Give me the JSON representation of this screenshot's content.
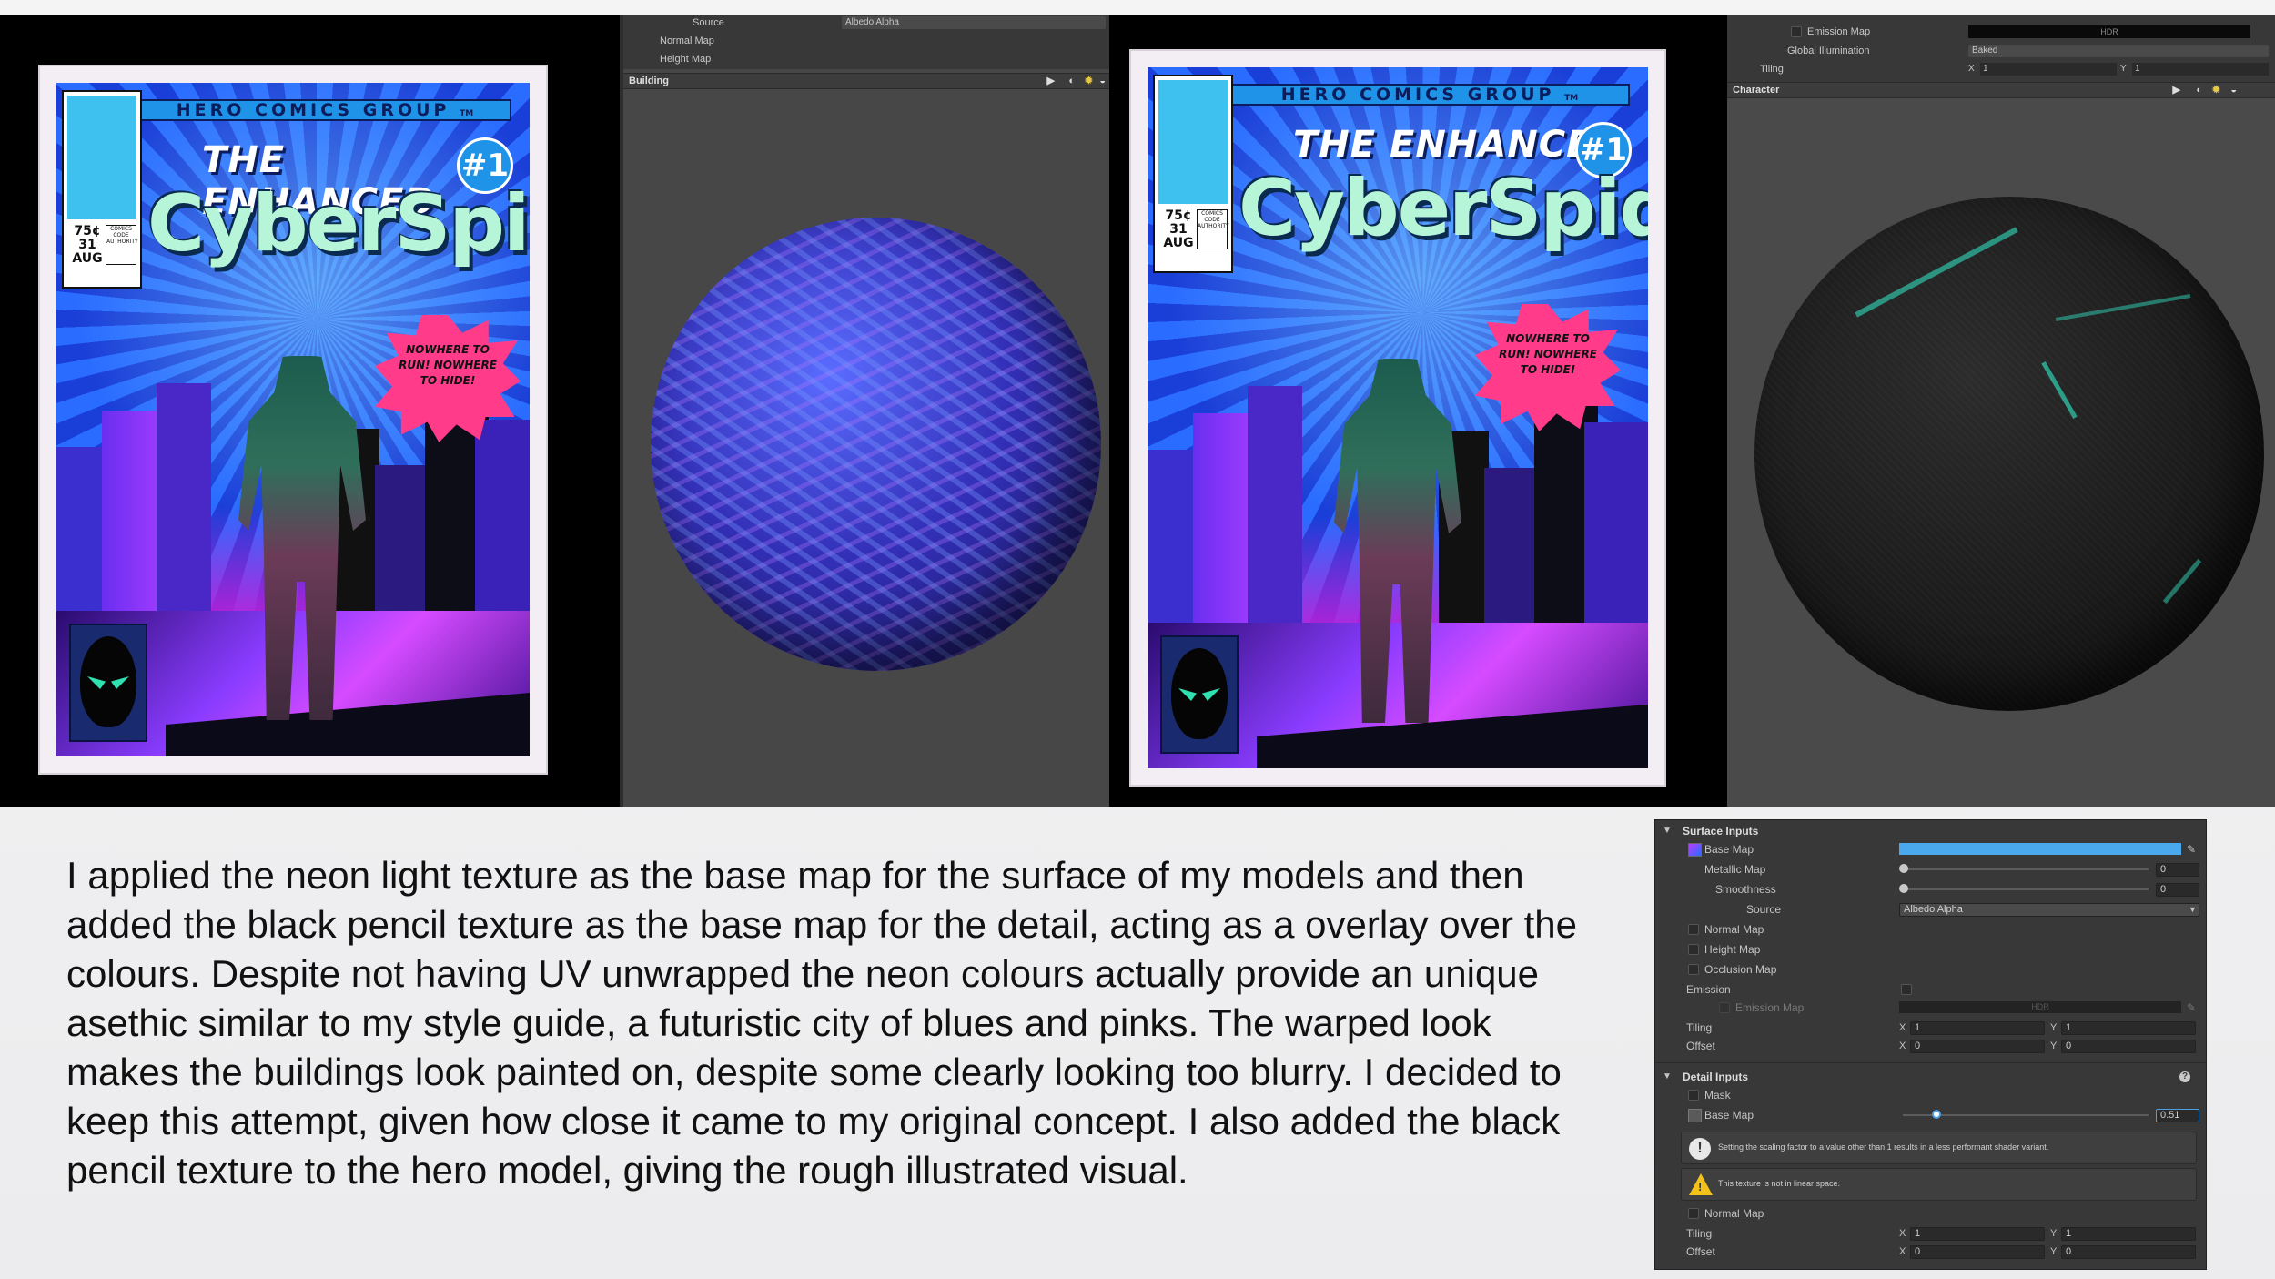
{
  "panel1": {
    "cover": {
      "header": "HERO COMICS GROUP",
      "header_tm": "TM",
      "title_small": "THE ENHANCED",
      "issue": "#1",
      "title_big": "CyberSpider",
      "price": "75¢",
      "date_day": "31",
      "date_month": "AUG",
      "code_text": "COMICS CODE AUTHORITY",
      "burst_text": "NOWHERE TO RUN! NOWHERE TO HIDE!"
    }
  },
  "panel2": {
    "rows": {
      "source_label": "Source",
      "source_value": "Albedo Alpha",
      "normal_map": "Normal Map",
      "height_map": "Height Map"
    },
    "header_label": "Building"
  },
  "panel3": {
    "cover": {
      "header": "HERO COMICS GROUP",
      "header_tm": "TM",
      "title_small": "THE ENHANCED",
      "issue": "#1",
      "title_big": "CyberSpider",
      "price": "75¢",
      "date_day": "31",
      "date_month": "AUG",
      "code_text": "COMICS CODE AUTHORITY",
      "burst_text": "NOWHERE TO RUN! NOWHERE TO HIDE!"
    }
  },
  "panel4": {
    "rows": {
      "emission_map": "Emission Map",
      "emission_value": "HDR",
      "gi_label": "Global Illumination",
      "gi_value": "Baked",
      "tiling_label": "Tiling",
      "tiling_x_label": "X",
      "tiling_x": "1",
      "tiling_y_label": "Y",
      "tiling_y": "1"
    },
    "header_label": "Character"
  },
  "body_text": "I applied the neon light texture as the base map for the surface of my models and then added the black pencil texture as the base map for the detail, acting as a overlay over the colours. Despite not having UV unwrapped the neon colours actually provide an unique asethic similar to my style guide, a futuristic city of blues and pinks. The warped look makes the buildings look painted on, despite some clearly looking too blurry. I decided to keep this attempt, given how close it came to my original concept. I also added the black pencil texture to the hero model, giving the rough illustrated visual.",
  "inspector": {
    "surface_inputs": "Surface Inputs",
    "base_map": "Base Map",
    "metallic_map": "Metallic Map",
    "metallic_value": "0",
    "smoothness": "Smoothness",
    "smoothness_value": "0",
    "source": "Source",
    "source_value": "Albedo Alpha",
    "normal_map": "Normal Map",
    "height_map": "Height Map",
    "occlusion_map": "Occlusion Map",
    "emission": "Emission",
    "emission_map": "Emission Map",
    "emission_value": "HDR",
    "tiling": "Tiling",
    "offset": "Offset",
    "x_label": "X",
    "y_label": "Y",
    "tiling_x": "1",
    "tiling_y": "1",
    "offset_x": "0",
    "offset_y": "0",
    "detail_inputs": "Detail Inputs",
    "mask": "Mask",
    "detail_base_map": "Base Map",
    "detail_base_value": "0.51",
    "detail_base_fraction": 0.51,
    "info_message": "Setting the scaling factor to a value other than 1 results in a less performant shader variant.",
    "warning_message": "This texture is not in linear space.",
    "detail_normal_map": "Normal Map",
    "detail_tiling": "Tiling",
    "detail_offset": "Offset",
    "detail_tiling_x": "1",
    "detail_tiling_y": "1",
    "detail_offset_x": "0",
    "detail_offset_y": "0"
  },
  "colors": {
    "accent": "#4aa0e6",
    "base_map_swatch": "#4aa8ec",
    "warning": "#f2c21b",
    "info": "#e8e8e8"
  }
}
